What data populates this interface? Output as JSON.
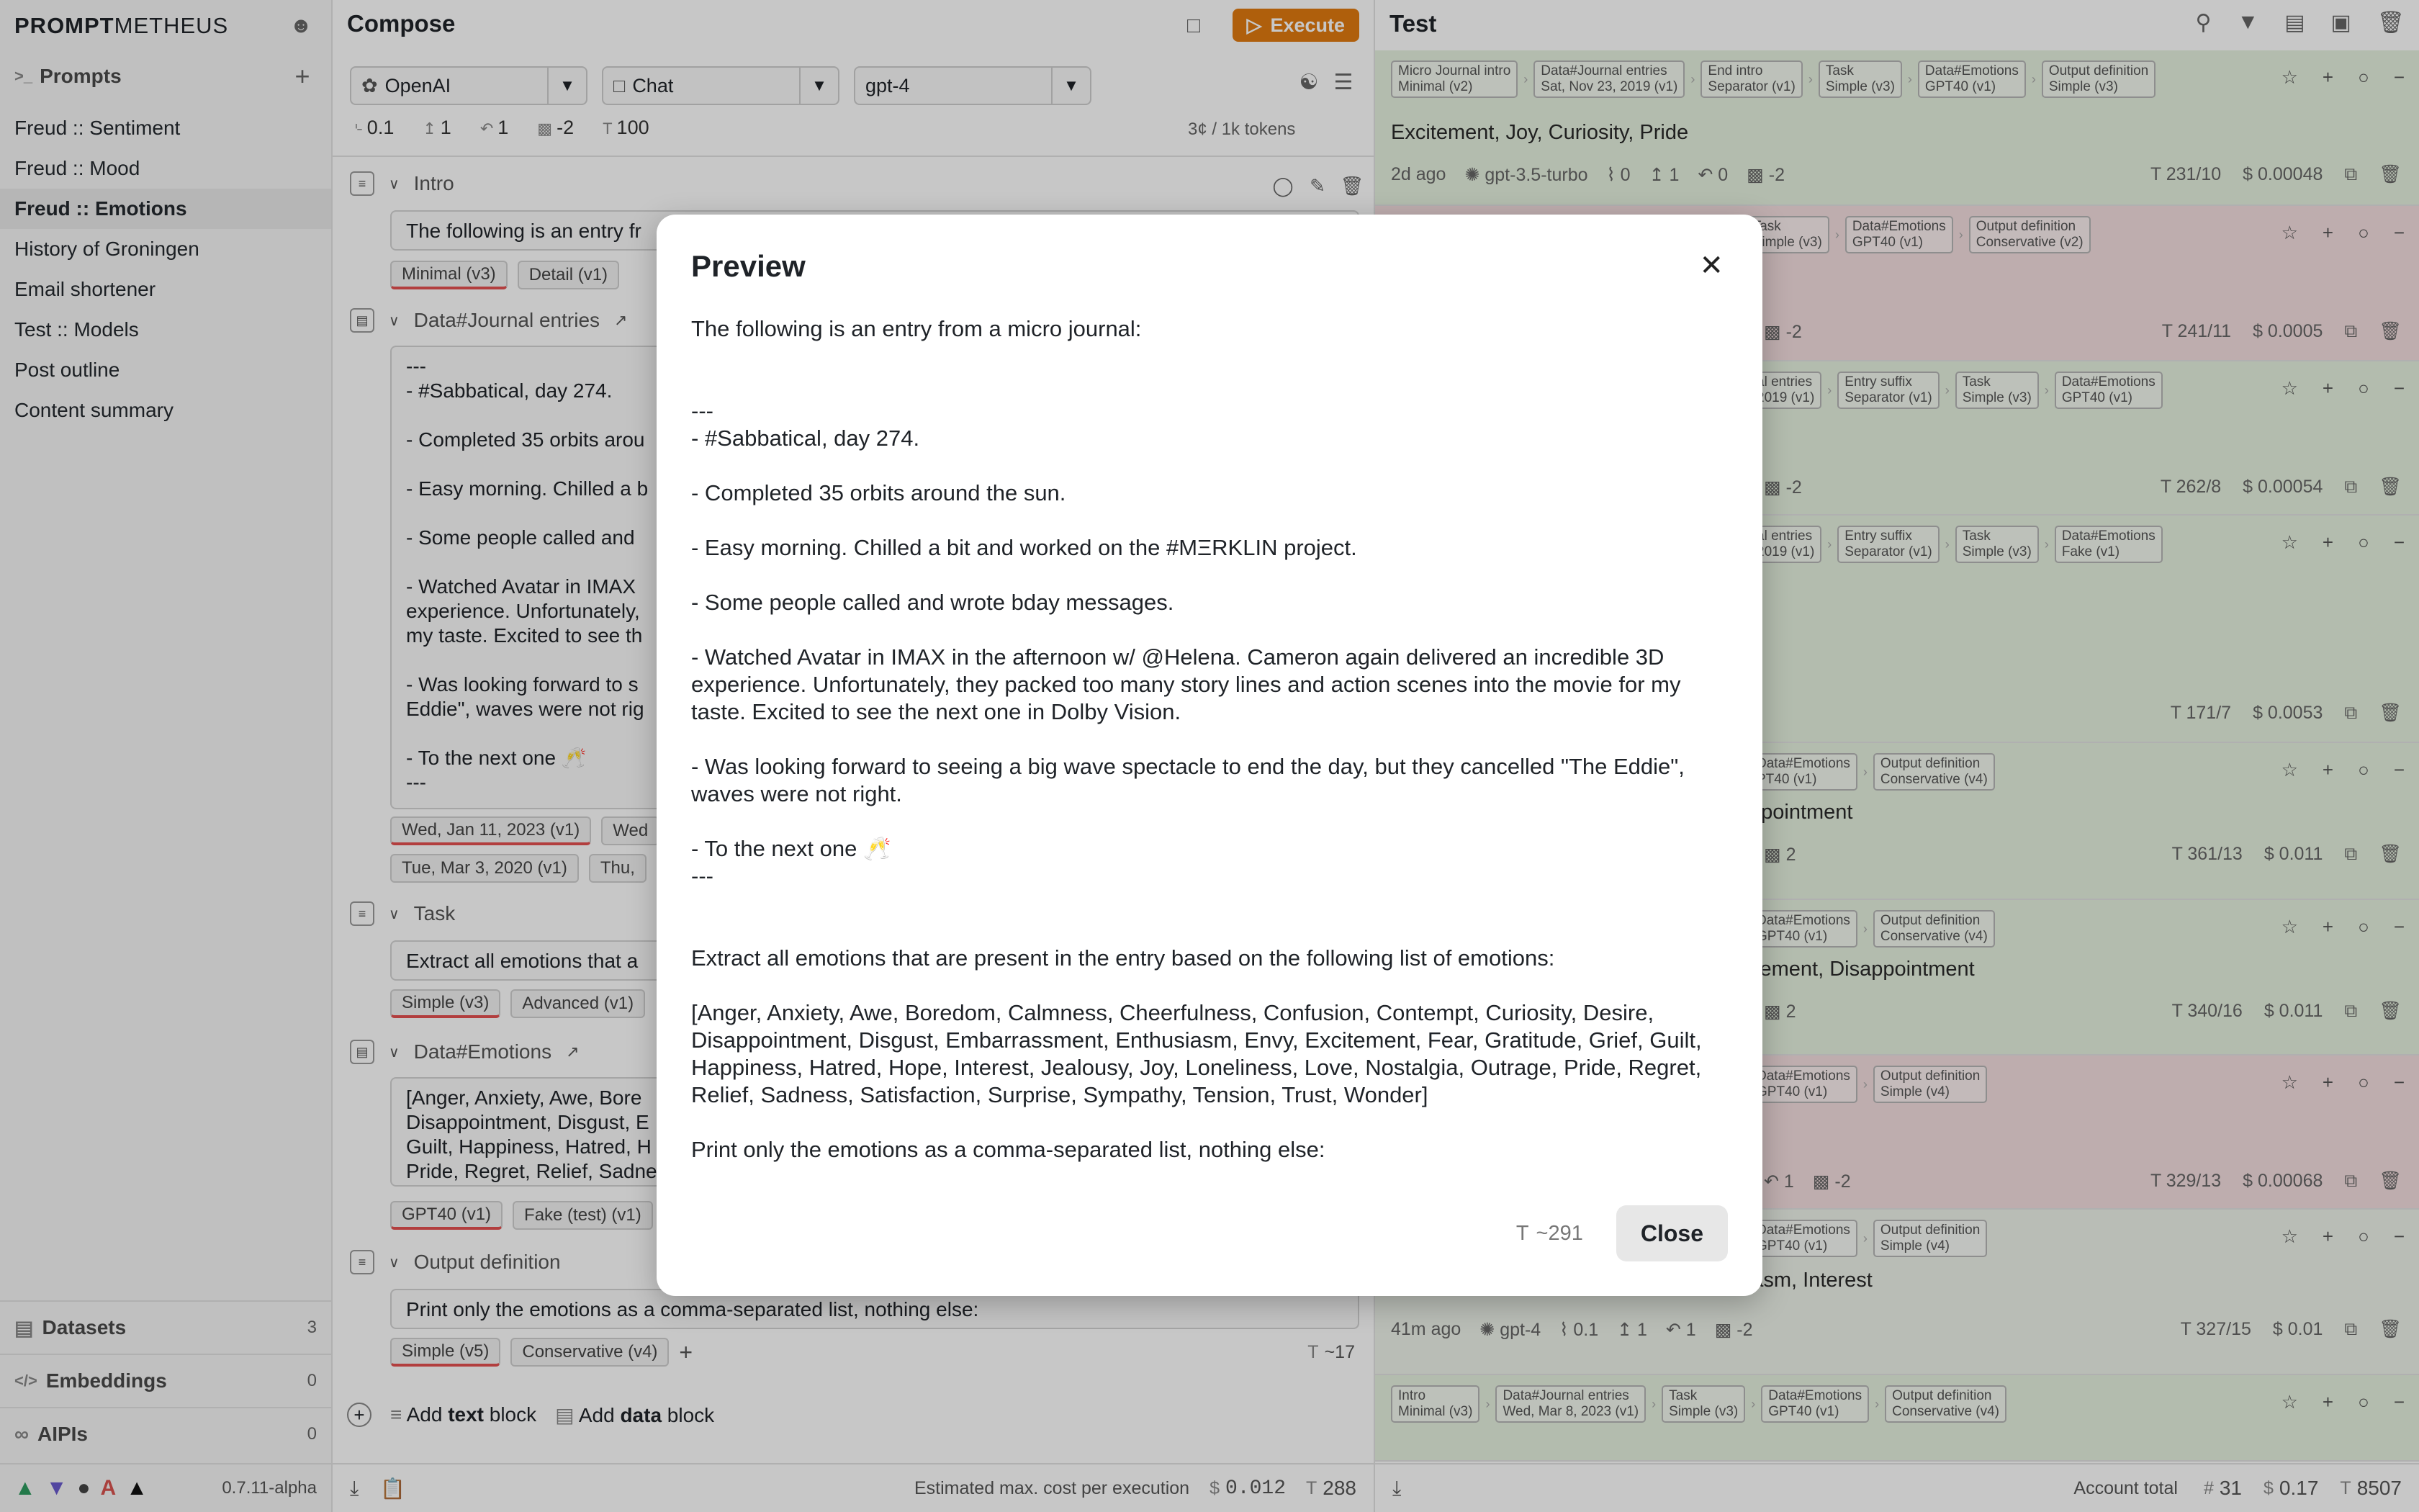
{
  "app": {
    "brand_bold": "PROMPT",
    "brand_thin": "METHEUS",
    "version": "0.7.11-alpha"
  },
  "sidebar": {
    "prompts_title": "Prompts",
    "items": [
      {
        "label": "Freud :: Sentiment"
      },
      {
        "label": "Freud :: Mood"
      },
      {
        "label": "Freud :: Emotions",
        "active": true
      },
      {
        "label": "History of Groningen"
      },
      {
        "label": "Email shortener"
      },
      {
        "label": "Test :: Models"
      },
      {
        "label": "Post outline"
      },
      {
        "label": "Content summary"
      }
    ],
    "sections": [
      {
        "label": "Datasets",
        "count": "3"
      },
      {
        "label": "Embeddings",
        "count": "0"
      },
      {
        "label": "AIPIs",
        "count": "0"
      }
    ]
  },
  "compose": {
    "title": "Compose",
    "execute_label": "Execute",
    "provider": "OpenAI",
    "mode": "Chat",
    "model": "gpt-4",
    "params": {
      "temperature": "0.1",
      "top_p": "1",
      "n": "1",
      "penalty": "-2",
      "max_tokens": "100"
    },
    "cost_per_tokens": "3¢ / 1k tokens",
    "blocks": {
      "intro": {
        "title": "Intro",
        "text": "The following is an entry fr",
        "chips": [
          "Minimal (v3)",
          "Detail (v1)"
        ]
      },
      "journal": {
        "title": "Data#Journal entries",
        "text": "---\n- #Sabbatical, day 274.\n\n- Completed 35 orbits arou\n\n- Easy morning. Chilled a b\n\n- Some people called and \n\n- Watched Avatar in IMAX \nexperience. Unfortunately,\nmy taste. Excited to see th\n\n- Was looking forward to s\nEddie\", waves were not rig\n\n- To the next one 🥂\n---",
        "chips": [
          "Wed, Jan 11, 2023 (v1)",
          "Wed",
          "Tue, Mar 3, 2020 (v1)",
          "Thu,"
        ]
      },
      "task": {
        "title": "Task",
        "text": "Extract all emotions that a",
        "chips": [
          "Simple (v3)",
          "Advanced (v1)"
        ]
      },
      "emotions": {
        "title": "Data#Emotions",
        "text": "[Anger, Anxiety, Awe, Bore\nDisappointment, Disgust, E\nGuilt, Happiness, Hatred, H\nPride, Regret, Relief, Sadne",
        "chips": [
          "GPT40 (v1)",
          "Fake (test) (v1)"
        ]
      },
      "output": {
        "title": "Output definition",
        "text": "Print only the emotions as a comma-separated list, nothing else:",
        "chips": [
          "Simple (v5)",
          "Conservative (v4)"
        ],
        "tokens": "~17"
      }
    },
    "add_text_prefix": "Add ",
    "add_text_bold": "text",
    "add_text_suffix": " block",
    "add_data_prefix": "Add ",
    "add_data_bold": "data",
    "add_data_suffix": " block",
    "footer": {
      "label": "Estimated max. cost per execution",
      "cost": "0.012",
      "tokens": "288"
    }
  },
  "test": {
    "title": "Test",
    "runs": [
      {
        "trail": [
          "Micro Journal intro\nMinimal (v2)",
          "Data#Journal entries\nSat, Nov 23, 2019 (v1)",
          "End intro\nSeparator (v1)",
          "Task\nSimple (v3)",
          "Data#Emotions\nGPT40 (v1)",
          "Output definition\nSimple (v3)"
        ],
        "output": "Excitement, Joy, Curiosity, Pride",
        "time": "2d ago",
        "model": "gpt-3.5-turbo",
        "t": "0",
        "p": "1",
        "n": "0",
        "pen": "-2",
        "tokens": "231/10",
        "cost": "0.00048",
        "color": "green"
      },
      {
        "trail": [
          "o\n(v1)",
          "Task\nSimple (v3)",
          "Data#Emotions\nGPT40 (v1)",
          "Output definition\nConservative (v2)"
        ],
        "output": "",
        "pen": "-2",
        "tokens": "241/11",
        "cost": "0.0005",
        "color": "red"
      },
      {
        "trail": [
          "al entries\n2019 (v1)",
          "Entry suffix\nSeparator (v1)",
          "Task\nSimple (v3)",
          "Data#Emotions\nGPT40 (v1)"
        ],
        "output": "",
        "pen": "-2",
        "tokens": "262/8",
        "cost": "0.00054",
        "color": "green"
      },
      {
        "trail": [
          "al entries\n2019 (v1)",
          "Entry suffix\nSeparator (v1)",
          "Task\nSimple (v3)",
          "Data#Emotions\nFake (v1)"
        ],
        "output": "",
        "tokens": "171/7",
        "cost": "0.0053",
        "color": "green"
      },
      {
        "trail": [
          "Data#Emotions\nPT40 (v1)",
          "Output definition\nConservative (v4)"
        ],
        "output": "ppointment",
        "pen": "2",
        "tokens": "361/13",
        "cost": "0.011",
        "color": "green"
      },
      {
        "trail": [
          "Data#Emotions\nGPT40 (v1)",
          "Output definition\nConservative (v4)"
        ],
        "output": "itement, Disappointment",
        "pen": "2",
        "tokens": "340/16",
        "cost": "0.011",
        "color": "green"
      },
      {
        "trail": [
          "Data#Emotions\nGPT40 (v1)",
          "Output definition\nSimple (v4)"
        ],
        "output": "",
        "n": "1",
        "pen": "-2",
        "tokens": "329/13",
        "cost": "0.00068",
        "color": "red"
      },
      {
        "trail": [
          "Data#Emotions\nGPT40 (v1)",
          "Output definition\nSimple (v4)"
        ],
        "output": "Tiredness, Curiosity, Gratitude, Enthusiasm, Interest",
        "time": "41m ago",
        "model": "gpt-4",
        "t": "0.1",
        "p": "1",
        "n": "1",
        "pen": "-2",
        "tokens": "327/15",
        "cost": "0.01",
        "color": "plain"
      },
      {
        "trail": [
          "Intro\nMinimal (v3)",
          "Data#Journal entries\nWed, Mar 8, 2023 (v1)",
          "Task\nSimple (v3)",
          "Data#Emotions\nGPT40 (v1)",
          "Output definition\nConservative (v4)"
        ],
        "output": "",
        "color": "green"
      }
    ],
    "footer": {
      "label": "Account total",
      "runs": "31",
      "cost": "0.17",
      "tokens": "8507"
    }
  },
  "modal": {
    "title": "Preview",
    "body": "The following is an entry from a micro journal:\n\n\n---\n- #Sabbatical, day 274.\n\n- Completed 35 orbits around the sun.\n\n- Easy morning. Chilled a bit and worked on the #MΞRKLIN project.\n\n- Some people called and wrote bday messages.\n\n- Watched Avatar in IMAX in the afternoon w/ @Helena. Cameron again delivered an incredible 3D experience. Unfortunately, they packed too many story lines and action scenes into the movie for my taste. Excited to see the next one in Dolby Vision.\n\n- Was looking forward to seeing a big wave spectacle to end the day, but they cancelled \"The Eddie\", waves were not right.\n\n- To the next one 🥂\n---\n\n\nExtract all emotions that are present in the entry based on the following list of emotions:\n\n[Anger, Anxiety, Awe, Boredom, Calmness, Cheerfulness, Confusion, Contempt, Curiosity, Desire, Disappointment, Disgust, Embarrassment, Enthusiasm, Envy, Excitement, Fear, Gratitude, Grief, Guilt, Happiness, Hatred, Hope, Interest, Jealousy, Joy, Loneliness, Love, Nostalgia, Outrage, Pride, Regret, Relief, Sadness, Satisfaction, Surprise, Sympathy, Tension, Trust, Wonder]\n\nPrint only the emotions as a comma-separated list, nothing else:",
    "tokens": "~291",
    "close_label": "Close"
  },
  "colors": {
    "execute": "#e07a10",
    "run_green": "#e6f1df",
    "run_red": "#f4dedf"
  }
}
